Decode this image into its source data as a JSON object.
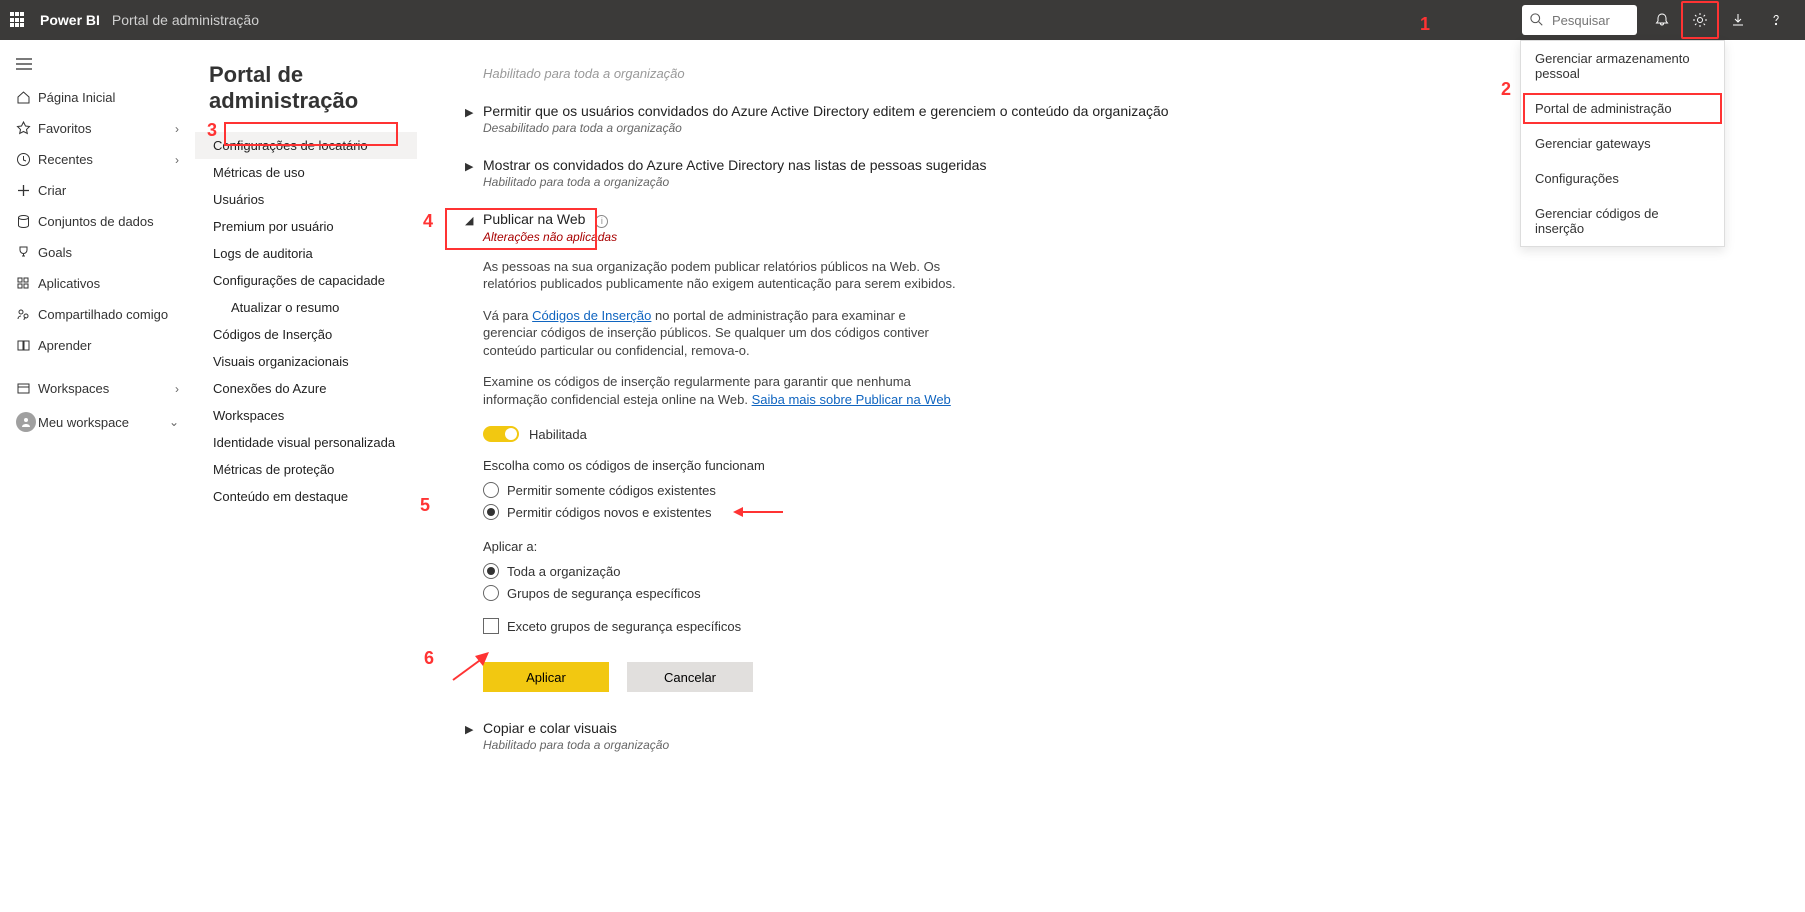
{
  "header": {
    "brand": "Power BI",
    "breadcrumb": "Portal de administração",
    "search_placeholder": "Pesquisar"
  },
  "dropdown": {
    "items": [
      "Gerenciar armazenamento pessoal",
      "Portal de administração",
      "Gerenciar gateways",
      "Configurações",
      "Gerenciar códigos de inserção"
    ]
  },
  "nav": {
    "home": "Página Inicial",
    "favorites": "Favoritos",
    "recent": "Recentes",
    "create": "Criar",
    "datasets": "Conjuntos de dados",
    "goals": "Goals",
    "apps": "Aplicativos",
    "shared": "Compartilhado comigo",
    "learn": "Aprender",
    "workspaces": "Workspaces",
    "myws": "Meu workspace"
  },
  "page_title": "Portal de administração",
  "subnav": [
    "Configurações de locatário",
    "Métricas de uso",
    "Usuários",
    "Premium por usuário",
    "Logs de auditoria",
    "Configurações de capacidade",
    "Atualizar o resumo",
    "Códigos de Inserção",
    "Visuais organizacionais",
    "Conexões do Azure",
    "Workspaces",
    "Identidade visual personalizada",
    "Métricas de proteção",
    "Conteúdo em destaque"
  ],
  "sections": {
    "top_fade": "Habilitado para toda a organização",
    "guest_edit": {
      "title": "Permitir que os usuários convidados do Azure Active Directory editem e gerenciem o conteúdo da organização",
      "sub": "Desabilitado para toda a organização"
    },
    "guest_list": {
      "title": "Mostrar os convidados do Azure Active Directory nas listas de pessoas sugeridas",
      "sub": "Habilitado para toda a organização"
    },
    "publish": {
      "title": "Publicar na Web",
      "sub": "Alterações não aplicadas",
      "desc1": "As pessoas na sua organização podem publicar relatórios públicos na Web. Os relatórios publicados publicamente não exigem autenticação para serem exibidos.",
      "desc2a": "Vá para ",
      "desc2link": "Códigos de Inserção",
      "desc2b": " no portal de administração para examinar e gerenciar códigos de inserção públicos. Se qualquer um dos códigos contiver conteúdo particular ou confidencial, remova-o.",
      "desc3a": "Examine os códigos de inserção regularmente para garantir que nenhuma informação confidencial esteja online na Web. ",
      "desc3link": "Saiba mais sobre Publicar na Web",
      "toggle_label": "Habilitada",
      "embed_heading": "Escolha como os códigos de inserção funcionam",
      "opt1": "Permitir somente códigos existentes",
      "opt2": "Permitir códigos novos e existentes",
      "apply_heading": "Aplicar a:",
      "optA": "Toda a organização",
      "optB": "Grupos de segurança específicos",
      "except": "Exceto grupos de segurança específicos",
      "apply_btn": "Aplicar",
      "cancel_btn": "Cancelar"
    },
    "copy_visuals": {
      "title": "Copiar e colar visuais",
      "sub": "Habilitado para toda a organização"
    }
  },
  "annotations": {
    "a1": "1",
    "a2": "2",
    "a3": "3",
    "a4": "4",
    "a5": "5",
    "a6": "6"
  }
}
